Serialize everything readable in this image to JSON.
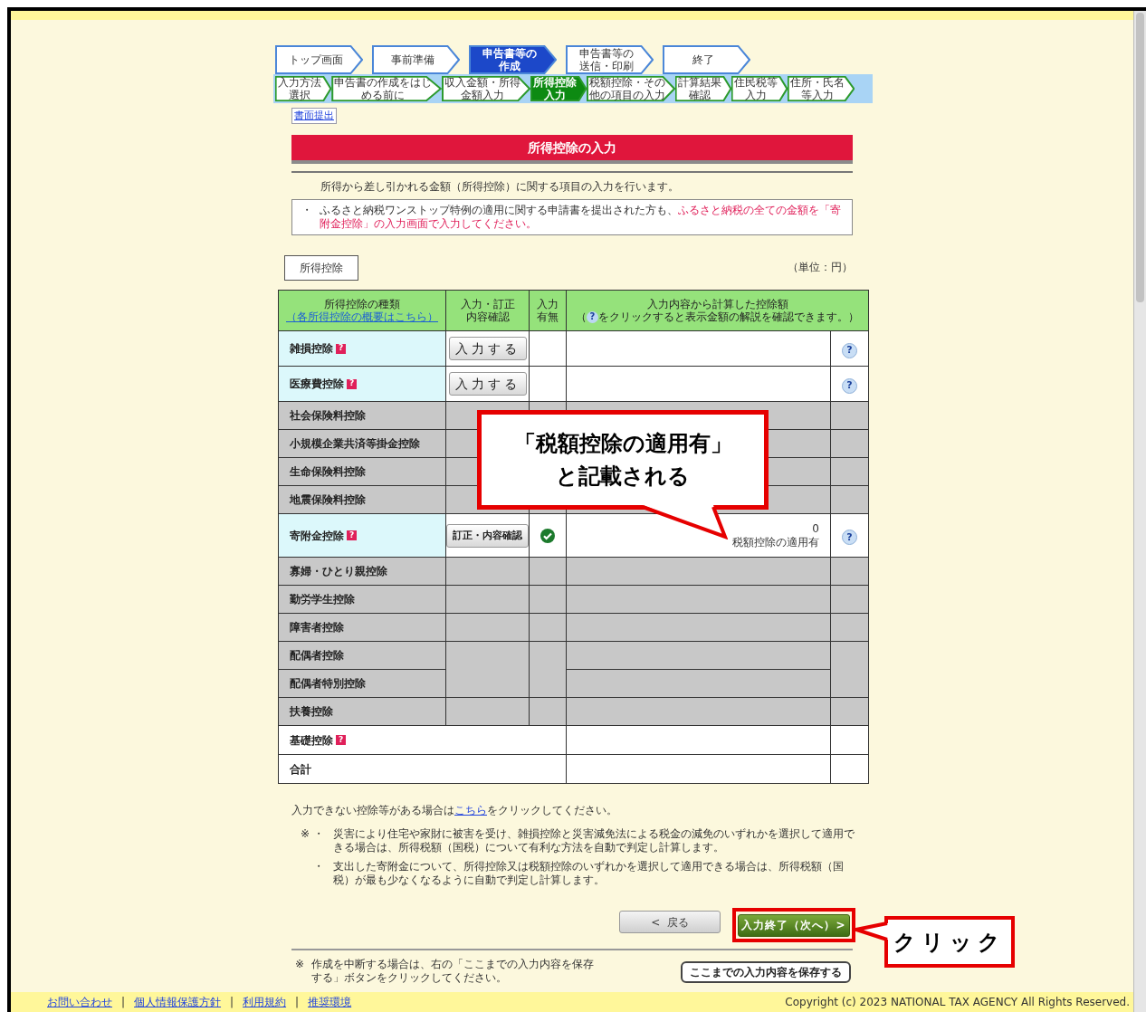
{
  "nav": {
    "steps": [
      {
        "lines": [
          "トップ画面"
        ],
        "selected": false
      },
      {
        "lines": [
          "事前準備"
        ],
        "selected": false
      },
      {
        "lines": [
          "申告書等の",
          "作成"
        ],
        "selected": true
      },
      {
        "lines": [
          "申告書等の",
          "送信・印刷"
        ],
        "selected": false
      },
      {
        "lines": [
          "終了"
        ],
        "selected": false
      }
    ],
    "substeps": [
      {
        "lines": [
          "入力方法",
          "選択"
        ],
        "selected": false
      },
      {
        "lines": [
          "申告書の作成をはじ",
          "める前に"
        ],
        "selected": false
      },
      {
        "lines": [
          "収入金額・所得",
          "金額入力"
        ],
        "selected": false
      },
      {
        "lines": [
          "所得控除",
          "入力"
        ],
        "selected": true
      },
      {
        "lines": [
          "税額控除・その",
          "他の項目の入力"
        ],
        "selected": false
      },
      {
        "lines": [
          "計算結果",
          "確認"
        ],
        "selected": false
      },
      {
        "lines": [
          "住民税等",
          "入力"
        ],
        "selected": false
      },
      {
        "lines": [
          "住所・氏名",
          "等入力"
        ],
        "selected": false
      }
    ]
  },
  "paper_link": "書面提出",
  "title": "所得控除の入力",
  "intro": "所得から差し引かれる金額（所得控除）に関する項目の入力を行います。",
  "notice": {
    "bullet": "・",
    "text": "ふるさと納税ワンストップ特例の適用に関する申請書を提出された方も、",
    "highlight": "ふるさと納税の全ての金額を「寄附金控除」の入力画面で入力してください。"
  },
  "section_tab": "所得控除",
  "unit": "（単位：円）",
  "table": {
    "columns": [
      {
        "lines": [
          "所得控除の種類"
        ],
        "link": "（各所得控除の概要はこちら）"
      },
      {
        "lines": [
          "入力・訂正",
          "内容確認"
        ]
      },
      {
        "lines": [
          "入力",
          "有無"
        ]
      },
      {
        "lines": [
          "入力内容から計算した控除額"
        ],
        "hint_before": "（",
        "hint_icon": "?",
        "hint_after": "をクリックすると表示金額の解説を確認できます。）"
      }
    ],
    "rows": [
      {
        "kind": "input",
        "label": "雑損控除",
        "help": "?",
        "button": "入力する",
        "entered": false,
        "explain": "?"
      },
      {
        "kind": "input",
        "label": "医療費控除",
        "help": "?",
        "button": "入力する",
        "entered": false,
        "explain": "?"
      },
      {
        "kind": "gray",
        "label": "社会保険料控除"
      },
      {
        "kind": "gray",
        "label": "小規模企業共済等掛金控除"
      },
      {
        "kind": "gray",
        "label": "生命保険料控除"
      },
      {
        "kind": "gray",
        "label": "地震保険料控除"
      },
      {
        "kind": "input",
        "label": "寄附金控除",
        "help": "?",
        "button": "訂正・内容確認",
        "entered": true,
        "amount": "0",
        "amount_note": "税額控除の適用有",
        "explain": "?"
      },
      {
        "kind": "gray",
        "label": "寡婦・ひとり親控除"
      },
      {
        "kind": "gray",
        "label": "勤労学生控除"
      },
      {
        "kind": "gray",
        "label": "障害者控除"
      },
      {
        "kind": "pair_top",
        "label": "配偶者控除"
      },
      {
        "kind": "pair_bottom",
        "label": "配偶者特別控除"
      },
      {
        "kind": "gray",
        "label": "扶養控除"
      },
      {
        "kind": "plain",
        "label": "基礎控除",
        "help": "?"
      },
      {
        "kind": "plain",
        "label": "合計"
      }
    ]
  },
  "after_note": {
    "before": "入力できない控除等がある場合は",
    "link": "こちら",
    "after": "をクリックしてください。"
  },
  "notes": {
    "mark": "※",
    "items": [
      {
        "bullet": "・",
        "text": "災害により住宅や家財に被害を受け、雑損控除と災害減免法による税金の減免のいずれかを選択して適用できる場合は、所得税額（国税）について有利な方法を自動で判定し計算します。"
      },
      {
        "bullet": "・",
        "text": "支出した寄附金について、所得控除又は税額控除のいずれかを選択して適用できる場合は、所得税額（国税）が最も少なくなるように自動で判定し計算します。"
      }
    ]
  },
  "buttons": {
    "back": "<  戻る",
    "next": "入力終了（次へ）>",
    "next_annotated": true
  },
  "save": {
    "note_mark": "※",
    "note": "作成を中断する場合は、右の「ここまでの入力内容を保存する」ボタンをクリックしてください。",
    "button": "ここまでの入力内容を保存する"
  },
  "footer": {
    "links": [
      "お問い合わせ",
      "個人情報保護方針",
      "利用規約",
      "推奨環境"
    ],
    "separators": [
      "|",
      "|",
      "|"
    ],
    "copyright": "Copyright (c) 2023 NATIONAL TAX AGENCY All Rights Reserved."
  },
  "annotations": [
    {
      "kind": "callout",
      "lines": [
        "「税額控除の適用有」",
        "と記載される"
      ]
    },
    {
      "kind": "label",
      "text": "クリック"
    }
  ]
}
